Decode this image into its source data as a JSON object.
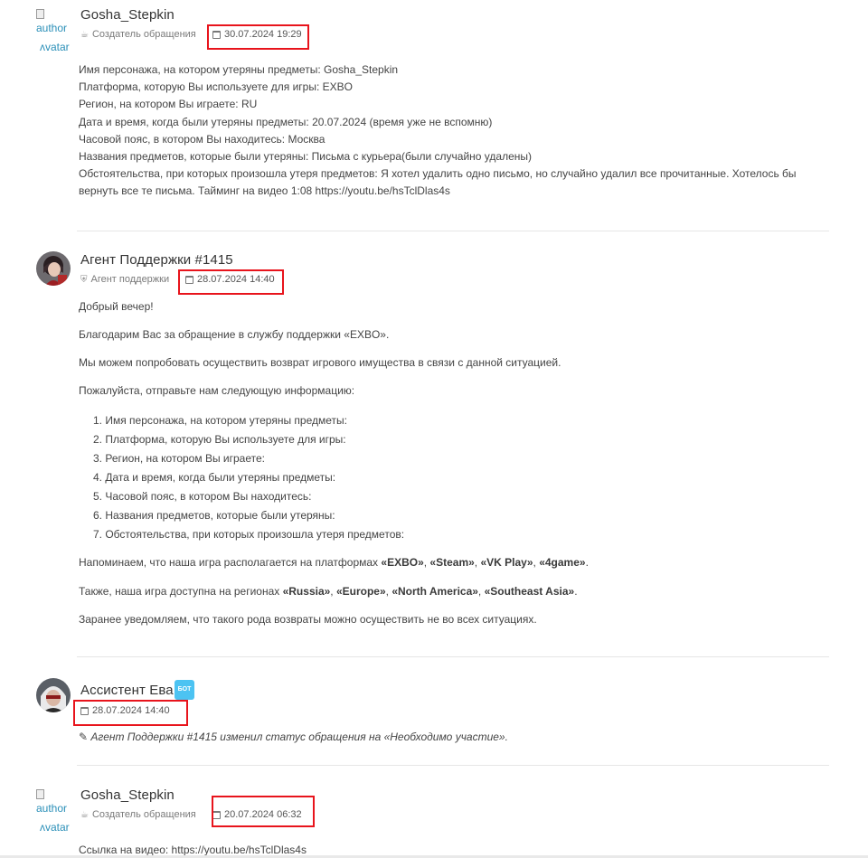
{
  "messages": [
    {
      "author": "Gosha_Stepkin",
      "avatar_alt_line1": "author",
      "avatar_alt_line2": "ʌvatar",
      "role": "Создатель обращения",
      "date": "30.07.2024 19:29",
      "lines": [
        "Имя персонажа, на котором утеряны предметы: Gosha_Stepkin",
        "Платформа, которую Вы используете для игры: EXBO",
        "Регион, на котором Вы играете: RU",
        "Дата и время, когда были утеряны предметы: 20.07.2024 (время уже не вспомню)",
        "Часовой пояс, в котором Вы находитесь: Москва",
        "Названия предметов, которые были утеряны: Письма с курьера(были случайно удалены)",
        "Обстоятельства, при которых произошла утеря предметов: Я хотел удалить одно письмо, но случайно удалил все прочитанные. Хотелось бы вернуть все те письма. Тайминг на видео 1:08 https://youtu.be/hsTclDlas4s"
      ]
    },
    {
      "author": "Агент Поддержки #1415",
      "role": "Агент поддержки",
      "date": "28.07.2024 14:40",
      "greeting": "Добрый вечер!",
      "thanks": "Благодарим Вас за обращение в службу поддержки «EXBO».",
      "offer": "Мы можем попробовать осуществить возврат игрового имущества в связи с данной ситуацией.",
      "request": "Пожалуйста, отправьте нам следующую информацию:",
      "list": [
        "1. Имя персонажа, на котором утеряны предметы:",
        "2. Платформа, которую Вы используете для игры:",
        "3. Регион, на котором Вы играете:",
        "4. Дата и время, когда были утеряны предметы:",
        "5. Часовой пояс, в котором Вы находитесь:",
        "6. Названия предметов, которые были утеряны:",
        "7. Обстоятельства, при которых произошла утеря предметов:"
      ],
      "platforms_prefix": "Напоминаем, что наша игра располагается на платформах ",
      "platforms": [
        "«EXBO»",
        "«Steam»",
        "«VK Play»",
        "«4game»"
      ],
      "regions_prefix": "Также, наша игра доступна на регионах ",
      "regions": [
        "«Russia»",
        "«Europe»",
        "«North America»",
        "«Southeast Asia»"
      ],
      "comma": ", ",
      "period": ".",
      "notice": "Заранее уведомляем, что такого рода возвраты можно осуществить не во всех ситуациях."
    },
    {
      "author": "Ассистент Ева",
      "badge": "БОТ",
      "date": "28.07.2024 14:40",
      "status_change": "Агент Поддержки #1415 изменил статус обращения на «Необходимо участие»."
    },
    {
      "author": "Gosha_Stepkin",
      "avatar_alt_line1": "author",
      "avatar_alt_line2": "ʌvatar",
      "role": "Создатель обращения",
      "date": "20.07.2024 06:32",
      "text": "Ссылка на видео: https://youtu.be/hsTclDlas4s"
    }
  ],
  "colors": {
    "highlight_box": "#e8141c",
    "bot_badge": "#4cc3f2",
    "link_avatar_alt": "#2a8fb8"
  },
  "icons": {
    "creator_role": "cup-icon",
    "agent_role": "shield-icon",
    "date": "calendar-icon",
    "status_change": "pencil-icon"
  }
}
